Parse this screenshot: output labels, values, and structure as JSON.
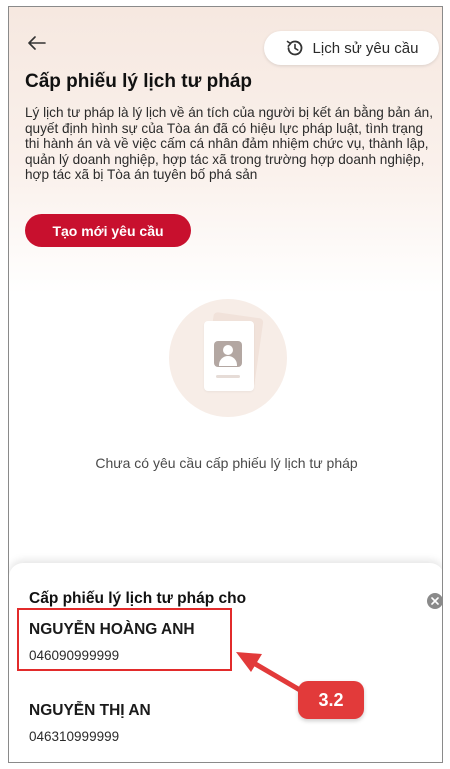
{
  "header": {
    "history_label": "Lịch sử yêu cầu",
    "title": "Cấp phiếu lý lịch tư pháp"
  },
  "description": "Lý lịch tư pháp là lý lịch về án tích của người bị kết án bằng bản án, quyết định hình sự của Tòa án đã có hiệu lực pháp luật, tình trạng thi hành án và về việc cấm cá nhân đảm nhiệm chức vụ, thành lập, quản lý doanh nghiệp, hợp tác xã trong trường hợp doanh nghiệp, hợp tác xã bị Tòa án tuyên bố phá sản",
  "create_button_label": "Tạo mới yêu cầu",
  "empty_state_text": "Chưa có yêu cầu cấp phiếu lý lịch tư pháp",
  "sheet": {
    "title": "Cấp phiếu lý lịch tư pháp cho",
    "people": [
      {
        "name": "NGUYỄN HOÀNG ANH",
        "id_number": "046090999999"
      },
      {
        "name": "NGUYỄN THỊ AN",
        "id_number": "046310999999"
      }
    ]
  },
  "annotation": {
    "step_label": "3.2"
  },
  "colors": {
    "brand_red": "#c8102e",
    "annotation_red": "#e22b2b"
  },
  "icons": {
    "back": "arrow-left-icon",
    "history": "history-clock-icon",
    "close": "close-circle-icon",
    "empty": "document-avatar-icon"
  }
}
